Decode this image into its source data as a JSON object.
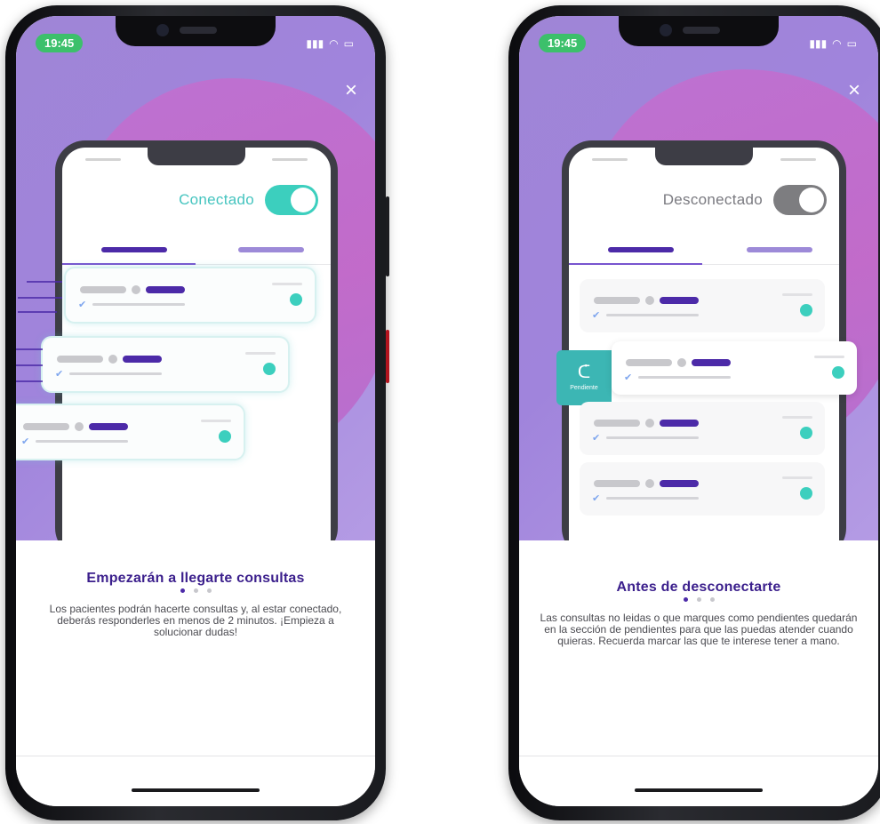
{
  "screens": [
    {
      "status_time": "19:45",
      "close_symbol": "×",
      "toggle_label": "Conectado",
      "toggle_state": "on",
      "title": "Empezarán a llegarte consultas",
      "description": "Los pacientes podrán hacerte consultas y, al estar conectado, deberás responderles en menos de 2 minutos. ¡Empieza a solucionar dudas!",
      "active_page": 1,
      "page_count": 3
    },
    {
      "status_time": "19:45",
      "close_symbol": "×",
      "toggle_label": "Desconectado",
      "toggle_state": "off",
      "pending_label": "Pendiente",
      "title": "Antes de desconectarte",
      "description": "Las consultas no leidas o que marques como pendientes quedarán en la sección de pendientes para que las puedas atender cuando quieras. Recuerda marcar las que te interese tener a mano.",
      "active_page": 1,
      "page_count": 3
    }
  ],
  "colors": {
    "accent_purple": "#4c2aa8",
    "teal": "#3ccfbe",
    "hero_purple": "#a084dc",
    "status_green": "#3cc06b"
  },
  "icons": [
    "signal-icon",
    "wifi-icon",
    "battery-icon",
    "close-icon",
    "check-icon",
    "pending-icon"
  ]
}
